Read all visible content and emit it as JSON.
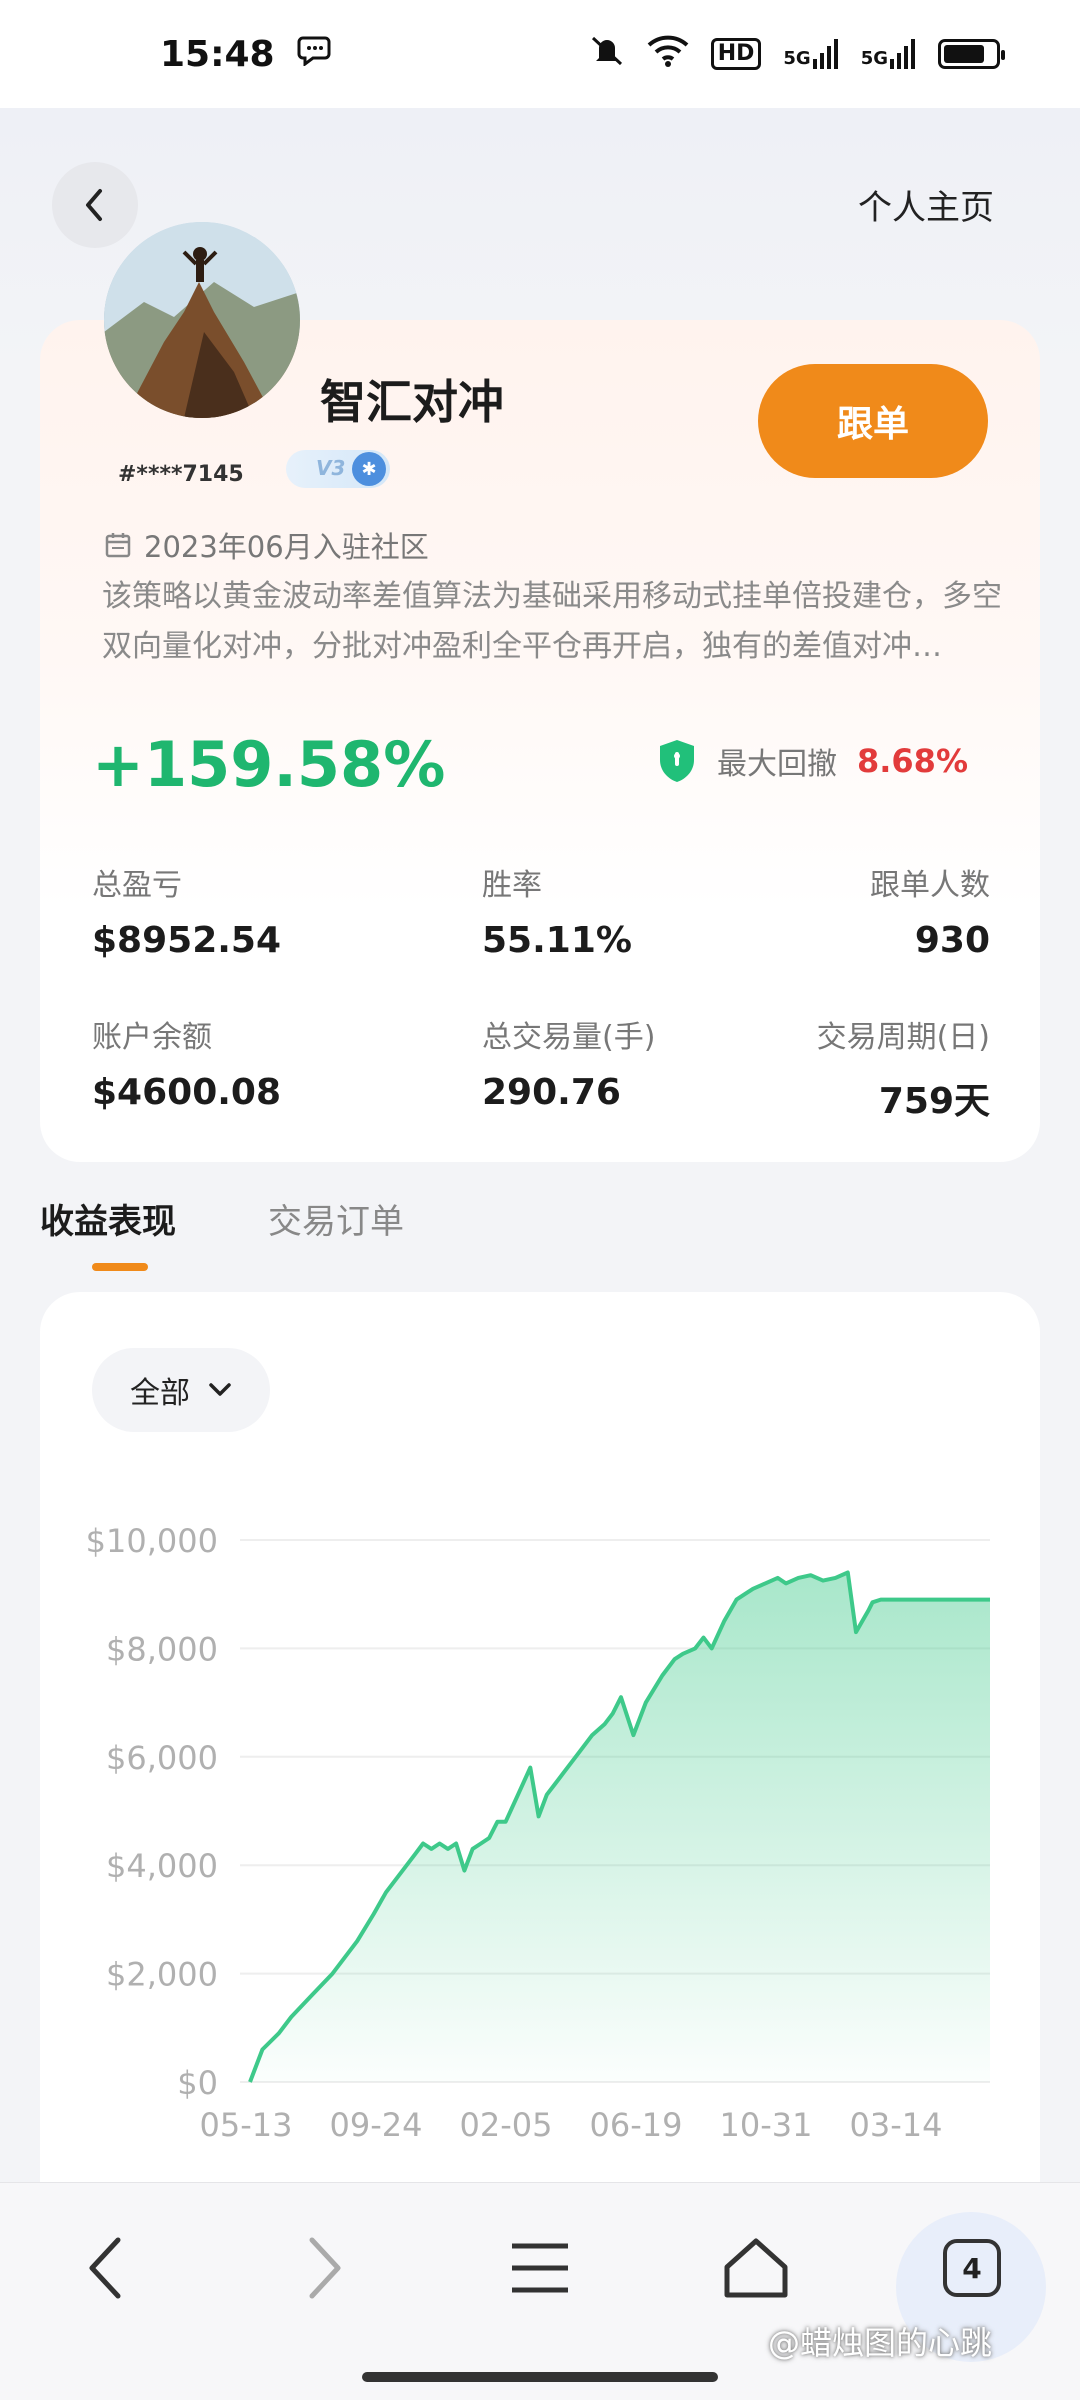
{
  "status_bar": {
    "time": "15:48",
    "icons": [
      "chat-icon",
      "mute-icon",
      "wifi-icon",
      "hd-icon",
      "5g-signal-icon",
      "5g-signal-icon",
      "battery-icon"
    ],
    "hd_label": "HD",
    "signal1_label": "5G",
    "signal2_label": "5G"
  },
  "header": {
    "back_icon": "chevron-left-icon",
    "right_link": "个人主页"
  },
  "profile": {
    "name": "智汇对冲",
    "user_id": "#****7145",
    "level": "V3",
    "follow_label": "跟单",
    "join_icon": "calendar-icon",
    "join_text": "2023年06月入驻社区",
    "description": "该策略以黄金波动率差值算法为基础采用移动式挂单倍投建仓，多空双向量化对冲，分批对冲盈利全平仓再开启，独有的差值对冲…"
  },
  "performance": {
    "total_return": "+159.58%",
    "drawdown_icon": "shield-icon",
    "drawdown_label": "最大回撤",
    "drawdown_value": "8.68%",
    "stats": [
      {
        "label": "总盈亏",
        "value": "$8952.54"
      },
      {
        "label": "胜率",
        "value": "55.11%"
      },
      {
        "label": "跟单人数",
        "value": "930"
      },
      {
        "label": "账户余额",
        "value": "$4600.08"
      },
      {
        "label": "总交易量(手)",
        "value": "290.76"
      },
      {
        "label": "交易周期(日)",
        "value": "759天"
      }
    ]
  },
  "tabs": [
    {
      "label": "收益表现",
      "active": true
    },
    {
      "label": "交易订单",
      "active": false
    }
  ],
  "range_selector": {
    "value": "全部",
    "icon": "chevron-down-icon"
  },
  "colors": {
    "accent": "#f08a1a",
    "positive": "#1fb66f",
    "negative": "#e23b3b",
    "line": "#3ec98a"
  },
  "chart_data": {
    "type": "area",
    "y_tick_labels": [
      "$0",
      "$2,000",
      "$4,000",
      "$6,000",
      "$8,000",
      "$10,000"
    ],
    "ylim": [
      0,
      10000
    ],
    "x_tick_labels": [
      "05-13",
      "09-24",
      "02-05",
      "06-19",
      "10-31",
      "03-14"
    ],
    "grid": true,
    "series": [
      {
        "x": [
          0,
          0.3,
          0.7,
          1.0,
          1.5,
          2.0,
          2.6,
          3.0,
          3.3,
          3.8,
          4.0,
          4.2,
          4.4,
          4.6,
          4.8,
          5.0,
          5.2,
          5.4,
          5.6,
          5.8,
          6.0,
          6.2,
          6.5,
          6.8,
          7.0,
          7.2,
          7.4,
          7.6,
          7.8,
          8.0,
          8.3,
          8.6,
          8.8,
          9.0,
          9.3,
          9.6,
          10.0,
          10.3,
          10.5,
          10.8,
          11.0,
          11.2,
          11.5,
          11.8,
          12.0,
          12.2,
          12.5,
          12.8,
          13.0,
          13.3,
          13.6,
          13.9,
          14.2,
          14.5,
          14.7,
          14.85,
          15.0,
          15.1,
          15.3,
          15.7,
          16.0,
          16.5,
          17.0,
          17.5,
          17.95
        ],
        "y": [
          0,
          600,
          900,
          1200,
          1600,
          2000,
          2600,
          3100,
          3500,
          4000,
          4200,
          4400,
          4300,
          4400,
          4300,
          4400,
          3900,
          4300,
          4400,
          4500,
          4800,
          4800,
          5300,
          5800,
          4900,
          5300,
          5500,
          5700,
          5900,
          6100,
          6400,
          6600,
          6800,
          7100,
          6400,
          7000,
          7500,
          7800,
          7900,
          8000,
          8200,
          8000,
          8500,
          8900,
          9000,
          9100,
          9200,
          9300,
          9200,
          9300,
          9350,
          9250,
          9300,
          9400,
          8300,
          8500,
          8700,
          8850,
          8900,
          8900,
          8900,
          8900,
          8900,
          8900,
          8900
        ]
      }
    ]
  },
  "bottom_nav": {
    "back_icon": "arrow-left-icon",
    "forward_icon": "arrow-right-icon",
    "menu_icon": "menu-icon",
    "home_icon": "home-icon",
    "tabs_count": "4"
  },
  "watermark": "@蜡烛图的心跳"
}
